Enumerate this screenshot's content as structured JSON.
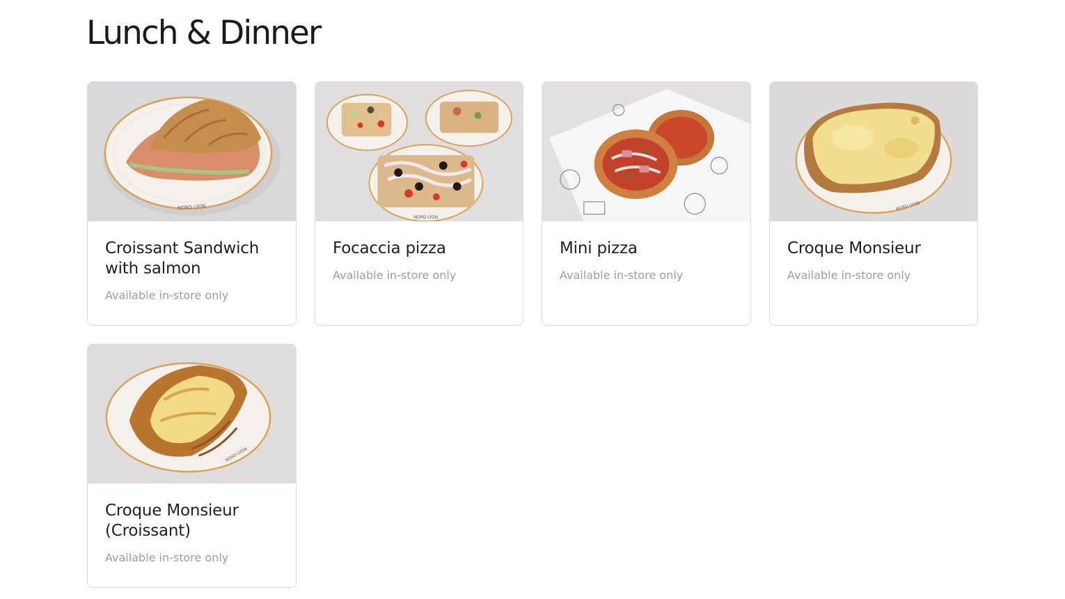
{
  "section": {
    "title": "Lunch & Dinner"
  },
  "items": [
    {
      "title": "Croissant Sandwich with salmon",
      "availability": "Available in-store only",
      "image_icon": "croissant-salmon-sandwich-photo"
    },
    {
      "title": "Focaccia pizza",
      "availability": "Available in-store only",
      "image_icon": "focaccia-pizza-photo"
    },
    {
      "title": "Mini pizza",
      "availability": "Available in-store only",
      "image_icon": "mini-pizza-photo"
    },
    {
      "title": "Croque Monsieur",
      "availability": "Available in-store only",
      "image_icon": "croque-monsieur-photo"
    },
    {
      "title": "Croque Monsieur (Croissant)",
      "availability": "Available in-store only",
      "image_icon": "croque-monsieur-croissant-photo"
    }
  ],
  "colors": {
    "background": "#ffffff",
    "card_border": "#dcdcdc",
    "title_text": "#1f1f1f",
    "muted_text": "#9c9c9c",
    "plate_rim": "#d9a35a",
    "photo_backdrop": "#e4e2e2"
  }
}
